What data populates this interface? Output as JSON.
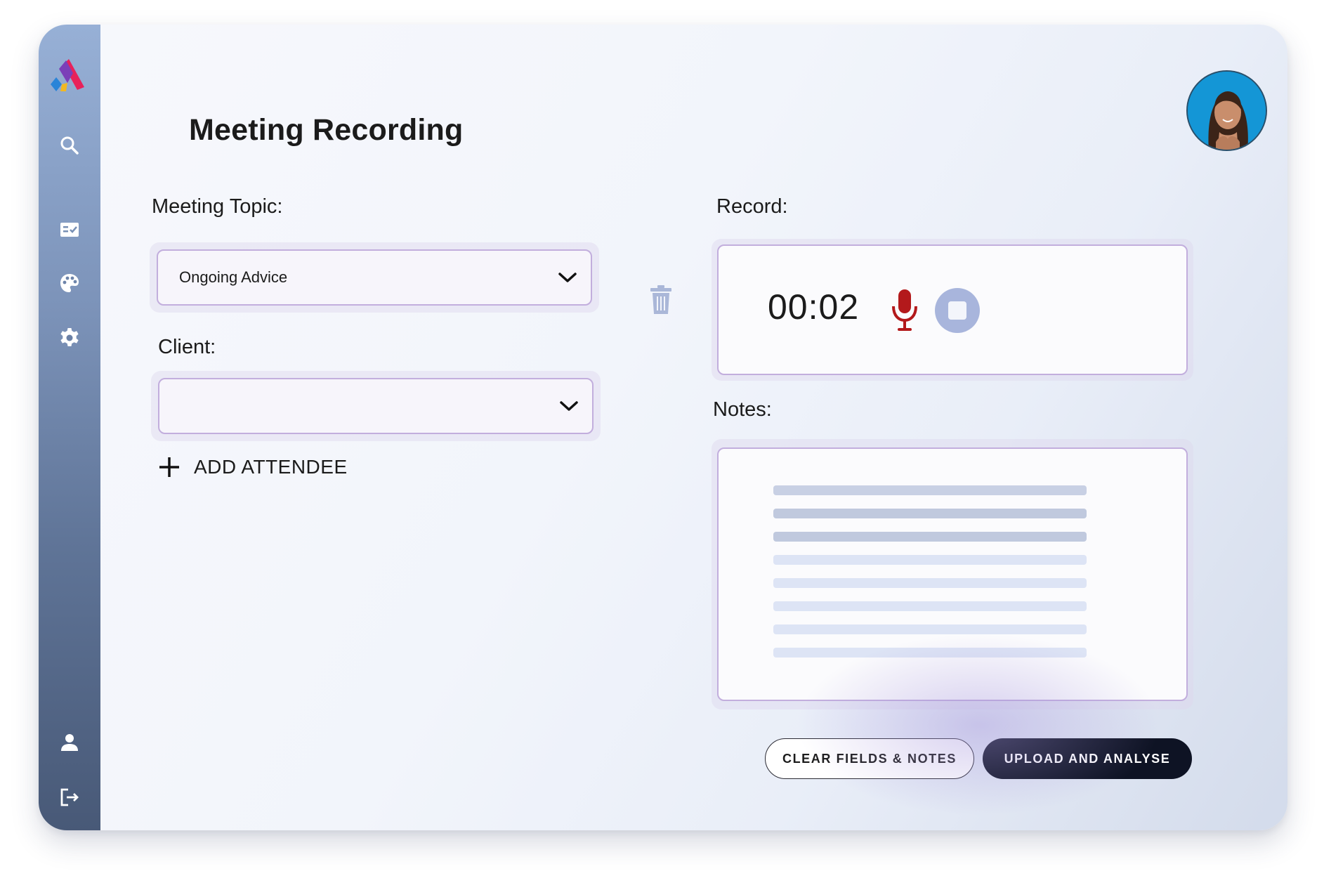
{
  "app": {
    "title": "Meeting Recording"
  },
  "sidebar": {
    "items": [
      {
        "name": "search",
        "icon": "search-icon"
      },
      {
        "name": "tasks",
        "icon": "checklist-icon"
      },
      {
        "name": "palette",
        "icon": "palette-icon"
      },
      {
        "name": "settings",
        "icon": "gear-icon"
      },
      {
        "name": "profile",
        "icon": "user-icon"
      },
      {
        "name": "logout",
        "icon": "logout-icon"
      }
    ]
  },
  "form": {
    "topic_label": "Meeting Topic:",
    "topic_value": "Ongoing Advice",
    "client_label": "Client:",
    "client_value": "",
    "add_attendee_label": "ADD ATTENDEE"
  },
  "record": {
    "label": "Record:",
    "timer": "00:02"
  },
  "notes": {
    "label": "Notes:"
  },
  "actions": {
    "clear_label": "CLEAR FIELDS & NOTES",
    "upload_label": "UPLOAD AND ANALYSE"
  },
  "colors": {
    "accent_dark": "#0e1324",
    "mic_red": "#b3191b",
    "field_border": "#c2aedd",
    "stop_button": "#a8b5dc"
  }
}
